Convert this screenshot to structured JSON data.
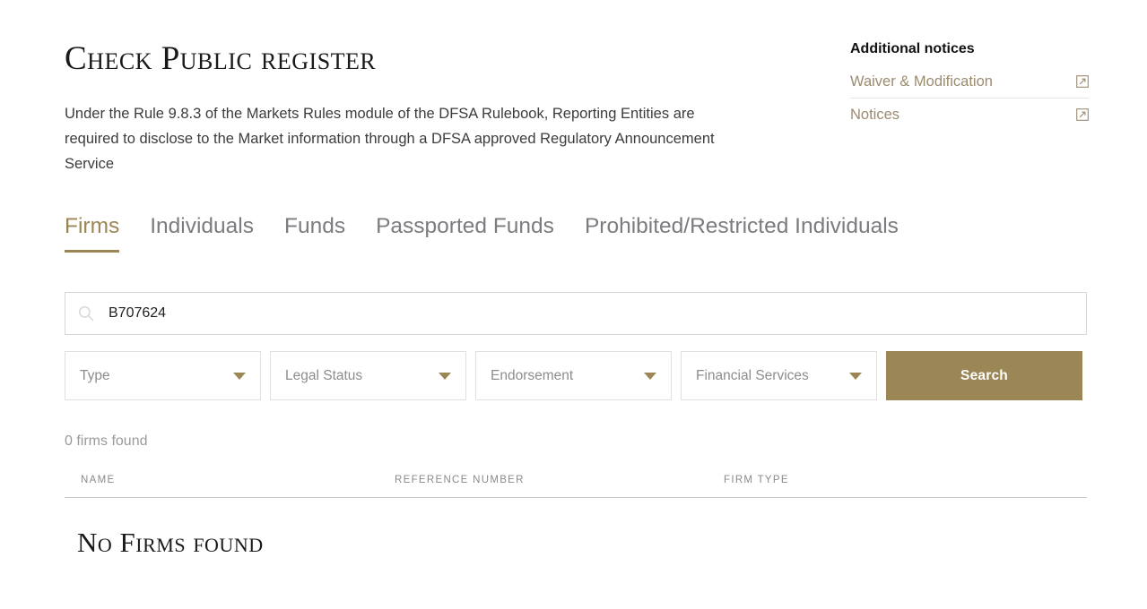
{
  "page": {
    "title": "Check Public register",
    "intro": "Under the Rule 9.8.3 of the Markets Rules module of the DFSA Rulebook, Reporting Entities are required to disclose to the Market information through a DFSA approved Regulatory Announcement Service"
  },
  "accent_color": "#9b8655",
  "tabs": [
    {
      "label": "Firms",
      "active": true
    },
    {
      "label": "Individuals",
      "active": false
    },
    {
      "label": "Funds",
      "active": false
    },
    {
      "label": "Passported Funds",
      "active": false
    },
    {
      "label": "Prohibited/Restricted Individuals",
      "active": false
    }
  ],
  "search": {
    "icon": "search-icon",
    "value": "B707624",
    "placeholder": "",
    "button_label": "Search"
  },
  "filters": [
    {
      "name": "type",
      "label": "Type",
      "icon": "chevron-down-icon"
    },
    {
      "name": "legal-status",
      "label": "Legal Status",
      "icon": "chevron-down-icon"
    },
    {
      "name": "endorsement",
      "label": "Endorsement",
      "icon": "chevron-down-icon"
    },
    {
      "name": "financial-services",
      "label": "Financial Services",
      "icon": "chevron-down-icon"
    }
  ],
  "results": {
    "count_text": "0 firms found",
    "columns": [
      "NAME",
      "REFERENCE NUMBER",
      "FIRM TYPE"
    ],
    "rows": [],
    "empty_message": "No Firms found"
  },
  "aside": {
    "title": "Additional notices",
    "links": [
      {
        "label": "Waiver & Modification",
        "icon": "external-link-icon"
      },
      {
        "label": "Notices",
        "icon": "external-link-icon"
      }
    ]
  }
}
